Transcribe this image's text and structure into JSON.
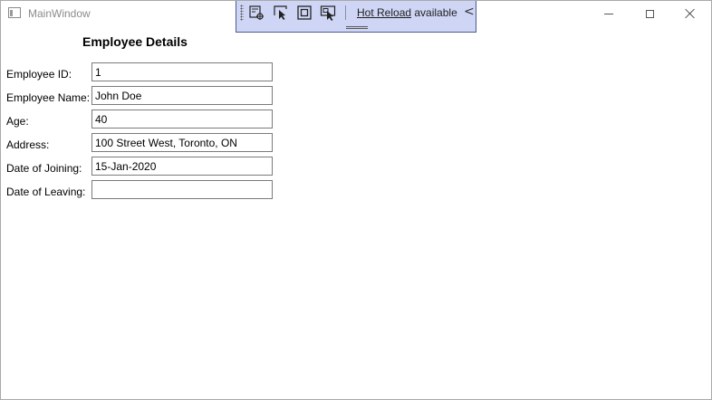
{
  "window": {
    "title": "MainWindow",
    "buttons": {
      "minimize_icon": "minimize-icon",
      "maximize_icon": "maximize-icon",
      "close_icon": "close-icon"
    }
  },
  "hot_reload": {
    "link_text": "Hot Reload",
    "status_text": " available",
    "collapse_glyph": "<",
    "tools": [
      "select-element-icon",
      "cursor-select-icon",
      "display-layout-adorners-icon",
      "track-focused-element-icon"
    ],
    "toolbar_color": "#cfd6f5"
  },
  "form": {
    "heading": "Employee Details",
    "fields": [
      {
        "label": "Employee ID:",
        "value": "1"
      },
      {
        "label": "Employee Name:",
        "value": "John Doe"
      },
      {
        "label": "Age:",
        "value": "40"
      },
      {
        "label": "Address:",
        "value": "100 Street West, Toronto, ON"
      },
      {
        "label": "Date of Joining:",
        "value": "15-Jan-2020"
      },
      {
        "label": "Date of Leaving:",
        "value": ""
      }
    ]
  }
}
